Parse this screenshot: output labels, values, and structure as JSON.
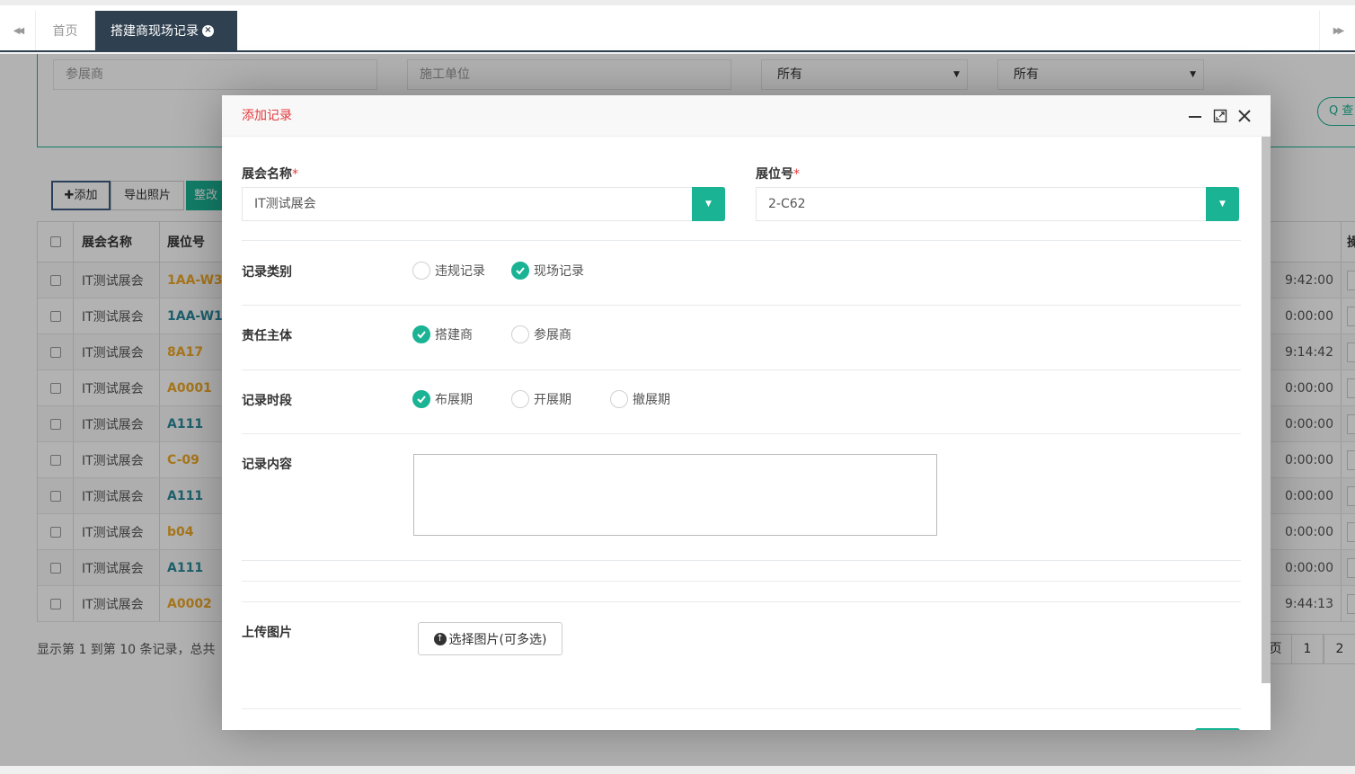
{
  "tabs": {
    "home_label": "首页",
    "active_label": "搭建商现场记录",
    "close_glyph": "×",
    "prev_glyph": "◀◀",
    "next_glyph": "▶▶"
  },
  "search": {
    "exhibitor_placeholder": "参展商",
    "contractor_placeholder": "施工单位",
    "select1_value": "所有",
    "select2_value": "所有",
    "query_label": "Q 查"
  },
  "toolbar": {
    "add_label": "✚添加",
    "export_label": "导出照片",
    "fix_label": "整改"
  },
  "table": {
    "headers": {
      "name": "展会名称",
      "booth": "展位号",
      "op": "操"
    },
    "rows": [
      {
        "name": "IT测试展会",
        "booth": "1AA-W3",
        "color": "orange",
        "time": "9:42:00"
      },
      {
        "name": "IT测试展会",
        "booth": "1AA-W1",
        "color": "teal",
        "time": "0:00:00"
      },
      {
        "name": "IT测试展会",
        "booth": "8A17",
        "color": "orange",
        "time": "9:14:42"
      },
      {
        "name": "IT测试展会",
        "booth": "A0001",
        "color": "orange",
        "time": "0:00:00"
      },
      {
        "name": "IT测试展会",
        "booth": "A111",
        "color": "teal",
        "time": "0:00:00"
      },
      {
        "name": "IT测试展会",
        "booth": "C-09",
        "color": "orange",
        "time": "0:00:00"
      },
      {
        "name": "IT测试展会",
        "booth": "A111",
        "color": "teal",
        "time": "0:00:00"
      },
      {
        "name": "IT测试展会",
        "booth": "b04",
        "color": "orange",
        "time": "0:00:00"
      },
      {
        "name": "IT测试展会",
        "booth": "A111",
        "color": "teal",
        "time": "0:00:00"
      },
      {
        "name": "IT测试展会",
        "booth": "A0002",
        "color": "orange",
        "time": "9:44:13"
      }
    ],
    "footer_info": "显示第 1 到第 10 条记录，总共",
    "pager": {
      "prev_fragment": "页",
      "page1": "1",
      "page2": "2"
    }
  },
  "modal": {
    "title": "添加记录",
    "expo_label": "展会名称",
    "expo_value": "IT测试展会",
    "booth_label": "展位号",
    "booth_value": "2-C62",
    "required_mark": "*",
    "record_type_label": "记录类别",
    "record_type_options": [
      "违规记录",
      "现场记录"
    ],
    "record_type_selected": "现场记录",
    "responsible_label": "责任主体",
    "responsible_options": [
      "搭建商",
      "参展商"
    ],
    "responsible_selected": "搭建商",
    "period_label": "记录时段",
    "period_options": [
      "布展期",
      "开展期",
      "撤展期"
    ],
    "period_selected": "布展期",
    "content_label": "记录内容",
    "upload_label": "上传图片",
    "upload_button": "选择图片(可多选)"
  },
  "colors": {
    "primary": "#1ab394",
    "nav_dark": "#2f4050",
    "title_red": "#e4393c",
    "booth_orange": "#f0a929",
    "booth_teal": "#2a8a9c"
  }
}
